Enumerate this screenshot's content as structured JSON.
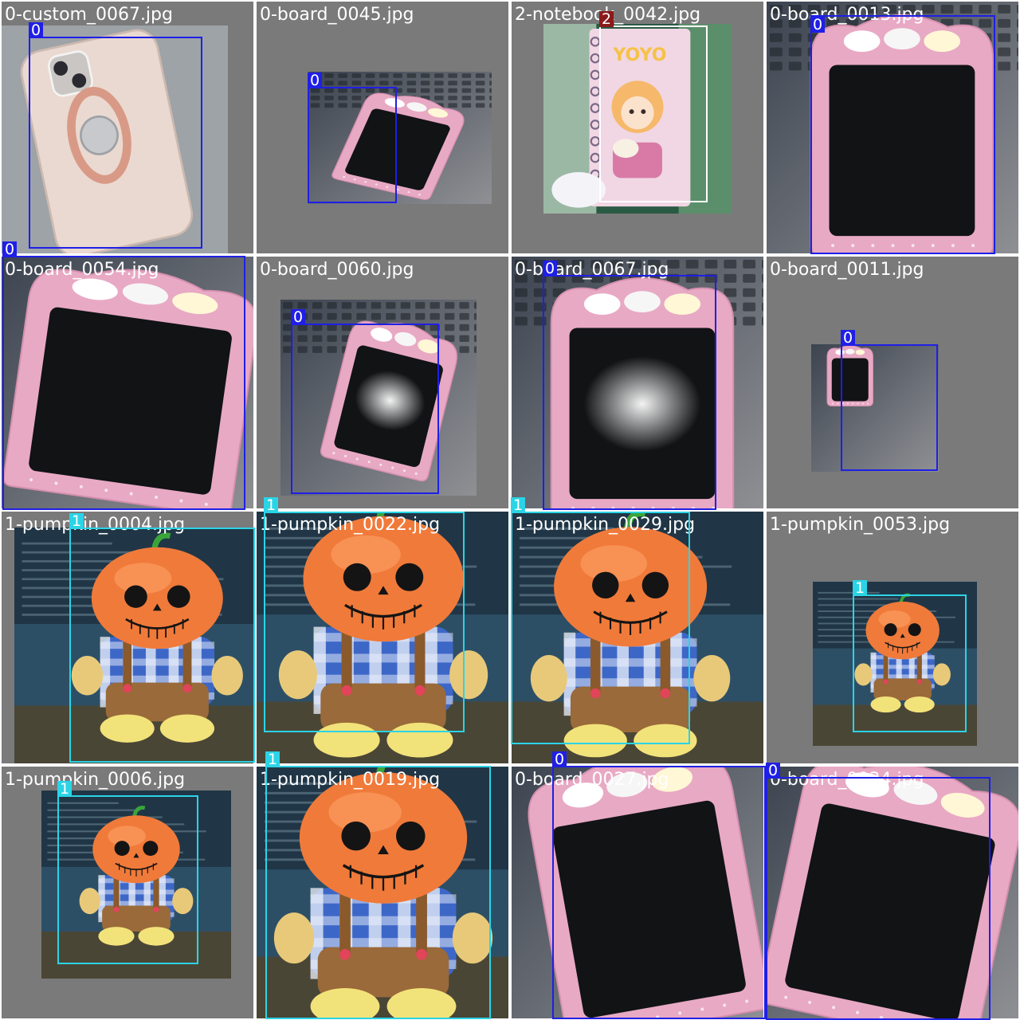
{
  "colors": {
    "class_0": "#1f1fe6",
    "class_1": "#2ad4e6",
    "class_2": "#ffffff",
    "class_2_label_bg": "#8b1a1a",
    "tile_background": "#7a7a7a"
  },
  "tiles": [
    {
      "filename": "0-custom_0067.jpg",
      "subject": "phone-case"
    },
    {
      "filename": "0-board_0045.jpg",
      "subject": "drawing-board"
    },
    {
      "filename": "2-notebook_0042.jpg",
      "subject": "notebook"
    },
    {
      "filename": "0-board_0013.jpg",
      "subject": "drawing-board"
    },
    {
      "filename": "0-board_0054.jpg",
      "subject": "drawing-board"
    },
    {
      "filename": "0-board_0060.jpg",
      "subject": "drawing-board"
    },
    {
      "filename": "0-board_0067.jpg",
      "subject": "drawing-board"
    },
    {
      "filename": "0-board_0011.jpg",
      "subject": "drawing-board"
    },
    {
      "filename": "1-pumpkin_0004.jpg",
      "subject": "pumpkin-plush"
    },
    {
      "filename": "1-pumpkin_0022.jpg",
      "subject": "pumpkin-plush"
    },
    {
      "filename": "1-pumpkin_0029.jpg",
      "subject": "pumpkin-plush"
    },
    {
      "filename": "1-pumpkin_0053.jpg",
      "subject": "pumpkin-plush"
    },
    {
      "filename": "1-pumpkin_0006.jpg",
      "subject": "pumpkin-plush"
    },
    {
      "filename": "1-pumpkin_0019.jpg",
      "subject": "pumpkin-plush"
    },
    {
      "filename": "0-board_0027.jpg",
      "subject": "drawing-board"
    },
    {
      "filename": "0-board_0034.jpg",
      "subject": "drawing-board"
    }
  ],
  "boxes": [
    {
      "label": "0",
      "cls": 0
    },
    {
      "label": "0",
      "cls": 0
    },
    {
      "label": "2",
      "cls": 2
    },
    {
      "label": "0",
      "cls": 0
    },
    {
      "label": "0",
      "cls": 0
    },
    {
      "label": "0",
      "cls": 0
    },
    {
      "label": "0",
      "cls": 0
    },
    {
      "label": "0",
      "cls": 0
    },
    {
      "label": "1",
      "cls": 1
    },
    {
      "label": "1",
      "cls": 1
    },
    {
      "label": "1",
      "cls": 1
    },
    {
      "label": "1",
      "cls": 1
    },
    {
      "label": "1",
      "cls": 1
    },
    {
      "label": "1",
      "cls": 1
    },
    {
      "label": "0",
      "cls": 0
    },
    {
      "label": "0",
      "cls": 0
    }
  ]
}
